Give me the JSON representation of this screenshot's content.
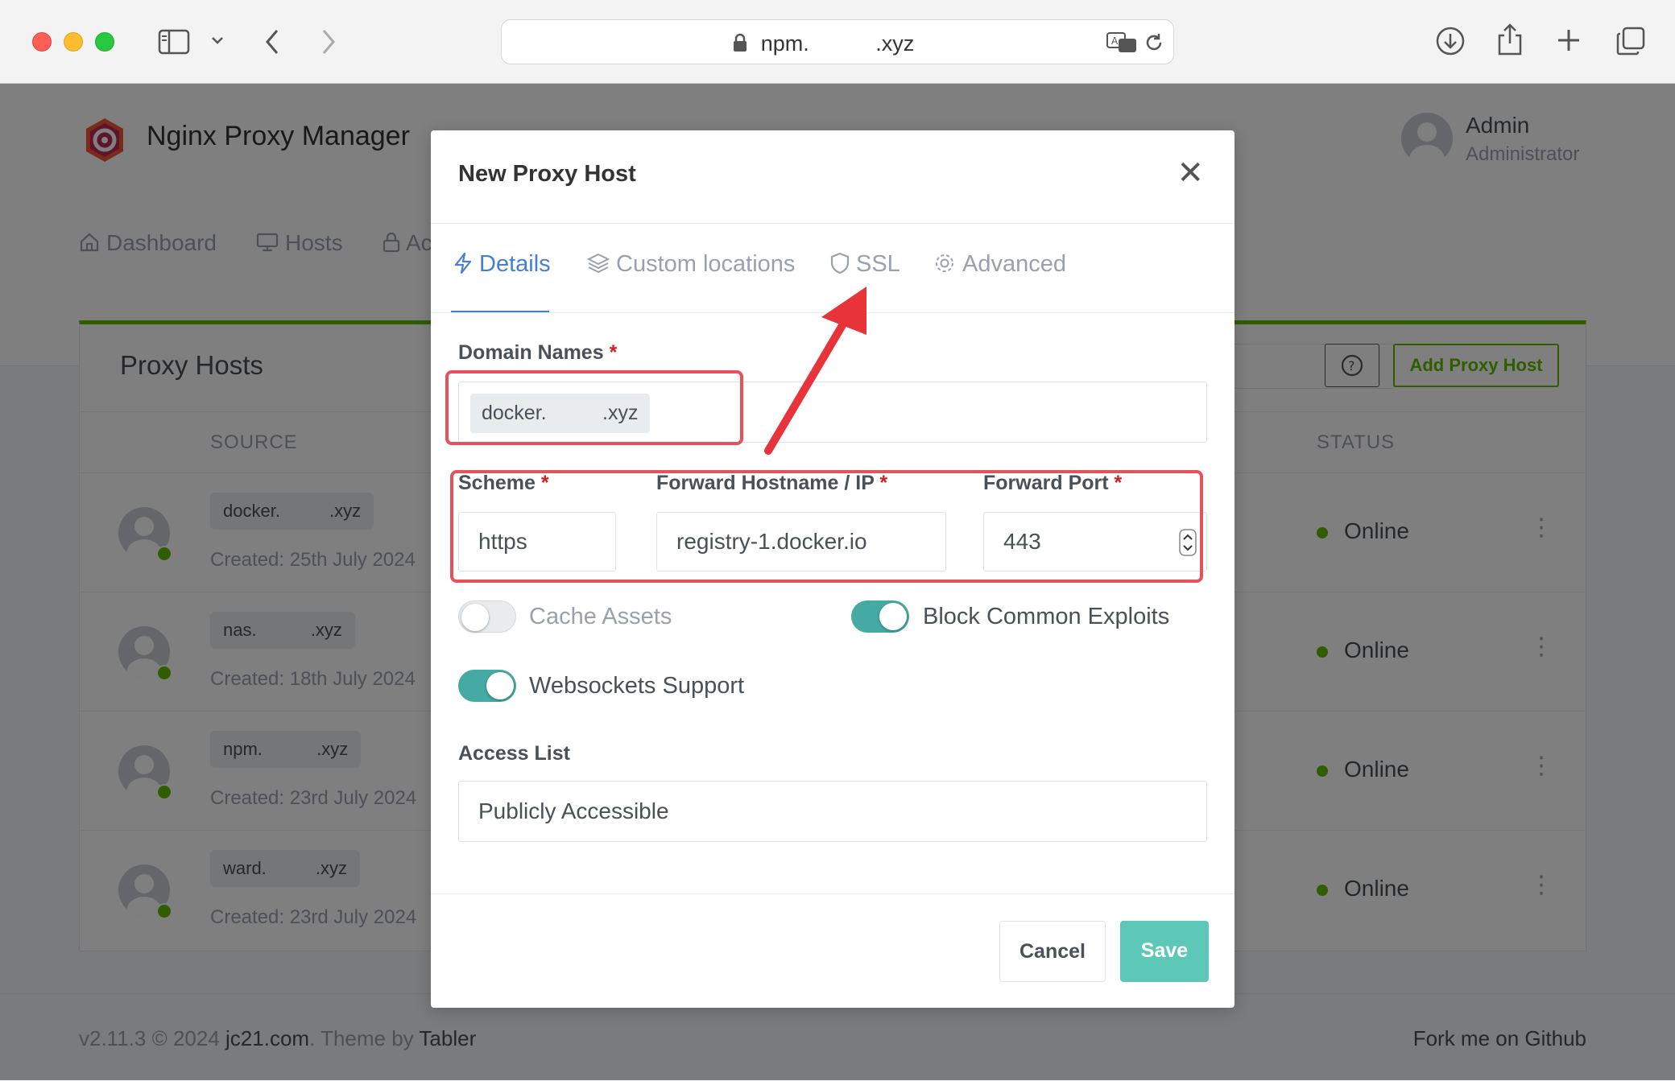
{
  "browser": {
    "url": "npm.           .xyz"
  },
  "app": {
    "brand": "Nginx Proxy Manager",
    "user": {
      "name": "Admin",
      "role": "Administrator"
    },
    "nav": [
      {
        "label": "Dashboard"
      },
      {
        "label": "Hosts"
      },
      {
        "label": "Ac"
      }
    ]
  },
  "card": {
    "title": "Proxy Hosts",
    "add_button": "Add Proxy Host",
    "columns": {
      "source": "SOURCE",
      "status": "STATUS"
    },
    "rows": [
      {
        "domain": "docker.          .xyz",
        "created": "Created: 25th July 2024",
        "status": "Online"
      },
      {
        "domain": "nas.           .xyz",
        "created": "Created: 18th July 2024",
        "status": "Online"
      },
      {
        "domain": "npm.           .xyz",
        "created": "Created: 23rd July 2024",
        "status": "Online"
      },
      {
        "domain": "ward.          .xyz",
        "created": "Created: 23rd July 2024",
        "status": "Online"
      }
    ]
  },
  "footer": {
    "version": "v2.11.3 © 2024 ",
    "link": "jc21.com",
    "theme_prefix": ". Theme by ",
    "theme": "Tabler",
    "fork": "Fork me on Github"
  },
  "modal": {
    "title": "New Proxy Host",
    "tabs": [
      {
        "label": "Details",
        "active": true
      },
      {
        "label": "Custom locations",
        "active": false
      },
      {
        "label": "SSL",
        "active": false
      },
      {
        "label": "Advanced",
        "active": false
      }
    ],
    "domain_names": {
      "label": "Domain Names",
      "value": "docker.          .xyz"
    },
    "scheme": {
      "label": "Scheme",
      "value": "https"
    },
    "forward_host": {
      "label": "Forward Hostname / IP",
      "value": "registry-1.docker.io"
    },
    "forward_port": {
      "label": "Forward Port",
      "value": "443"
    },
    "toggles": {
      "cache_assets": {
        "label": "Cache Assets",
        "on": false
      },
      "block_exploits": {
        "label": "Block Common Exploits",
        "on": true
      },
      "websockets": {
        "label": "Websockets Support",
        "on": true
      }
    },
    "access_list": {
      "label": "Access List",
      "value": "Publicly Accessible"
    },
    "cancel": "Cancel",
    "save": "Save"
  },
  "colors": {
    "accent": "#467fcf",
    "success": "#5eba00",
    "toggle_on": "#45aaa3",
    "save": "#5ec8b8",
    "annotation": "#e8505b"
  }
}
